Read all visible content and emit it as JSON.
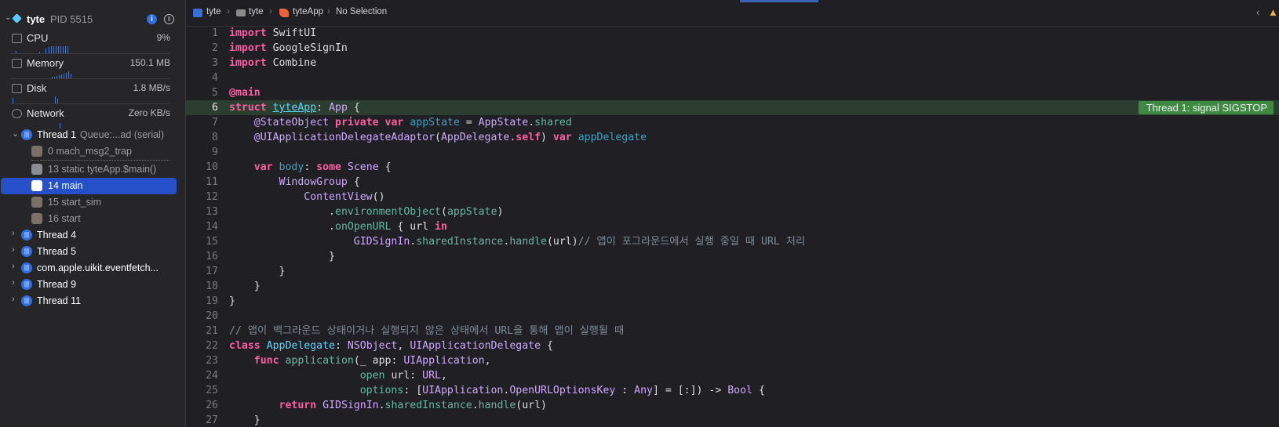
{
  "process": {
    "name": "tyte",
    "pid": "PID 5515"
  },
  "gauges": [
    {
      "label": "CPU",
      "value": "9%"
    },
    {
      "label": "Memory",
      "value": "150.1 MB"
    },
    {
      "label": "Disk",
      "value": "1.8 MB/s"
    },
    {
      "label": "Network",
      "value": "Zero KB/s"
    }
  ],
  "threads": [
    {
      "name": "Thread 1",
      "queue": "Queue:...ad (serial)",
      "expanded": true
    },
    {
      "name": "Thread 4"
    },
    {
      "name": "Thread 5"
    },
    {
      "name": "com.apple.uikit.eventfetch..."
    },
    {
      "name": "Thread 9"
    },
    {
      "name": "Thread 11"
    }
  ],
  "frames": [
    {
      "label": "0 mach_msg2_trap"
    },
    {
      "label": "13 static tyteApp.$main()"
    },
    {
      "label": "14 main",
      "selected": true
    },
    {
      "label": "15 start_sim"
    },
    {
      "label": "16 start"
    }
  ],
  "breadcrumb": {
    "project": "tyte",
    "folder": "tyte",
    "file": "tyteApp",
    "selection": "No Selection"
  },
  "banner": "Thread 1: signal SIGSTOP",
  "code": {
    "l1": {
      "n": "1",
      "kw": "import",
      "rest": " SwiftUI"
    },
    "l2": {
      "n": "2",
      "kw": "import",
      "rest": " GoogleSignIn"
    },
    "l3": {
      "n": "3",
      "kw": "import",
      "rest": " Combine"
    },
    "l4": {
      "n": "4"
    },
    "l5": {
      "n": "5",
      "attr": "@main"
    },
    "l6": {
      "n": "6",
      "kw": "struct",
      "name": "tyteApp",
      "rest": ": ",
      "type": "App",
      "end": " {"
    },
    "l7": {
      "n": "7",
      "attr": "@StateObject",
      "kw1": "private",
      "kw2": "var",
      "prop": "appState",
      "eq": " = ",
      "type": "AppState",
      "dot": ".",
      "member": "shared"
    },
    "l8": {
      "n": "8",
      "attr": "@UIApplicationDelegateAdaptor",
      "open": "(",
      "type": "AppDelegate",
      "dot": ".",
      "kwself": "self",
      "close": ") ",
      "kw": "var",
      "prop": "appDelegate"
    },
    "l9": {
      "n": "9"
    },
    "l10": {
      "n": "10",
      "kw": "var",
      "prop": "body",
      "colon": ": ",
      "kw2": "some",
      "type": "Scene",
      "end": " {"
    },
    "l11": {
      "n": "11",
      "type": "WindowGroup",
      "end": " {"
    },
    "l12": {
      "n": "12",
      "type": "ContentView",
      "end": "()"
    },
    "l13": {
      "n": "13",
      "dot": ".",
      "method": "environmentObject",
      "open": "(",
      "arg": "appState",
      "close": ")"
    },
    "l14": {
      "n": "14",
      "dot": ".",
      "method": "onOpenURL",
      "mid": " { url ",
      "kw": "in"
    },
    "l15": {
      "n": "15",
      "type": "GIDSignIn",
      "dot": ".",
      "member": "sharedInstance",
      "dot2": ".",
      "method": "handle",
      "args": "(url)",
      "comment": "// 앱이 포그라운드에서 실행 중일 때 URL 처리"
    },
    "l16": {
      "n": "16",
      "src": "}"
    },
    "l17": {
      "n": "17",
      "src": "}"
    },
    "l18": {
      "n": "18",
      "src": "}"
    },
    "l19": {
      "n": "19",
      "src": "}"
    },
    "l20": {
      "n": "20"
    },
    "l21": {
      "n": "21",
      "comment": "// 앱이 백그라운드 상태이거나 실행되지 않은 상태에서 URL을 통해 앱이 실행될 때"
    },
    "l22": {
      "n": "22",
      "kw": "class",
      "name": "AppDelegate",
      "colon": ": ",
      "type1": "NSObject",
      "comma": ", ",
      "type2": "UIApplicationDelegate",
      "end": " {"
    },
    "l23": {
      "n": "23",
      "kw": "func",
      "method": "application",
      "open": "(_ app: ",
      "type": "UIApplication",
      "end": ","
    },
    "l24": {
      "n": "24",
      "label": "open",
      "mid": " url: ",
      "type": "URL",
      "end": ","
    },
    "l25": {
      "n": "25",
      "label": "options",
      "mid": ": [",
      "type1": "UIApplication",
      "dot": ".",
      "type2": "OpenURLOptionsKey",
      "mid2": " : ",
      "type3": "Any",
      "mid3": "] = [:]) -> ",
      "type4": "Bool",
      "end": " {"
    },
    "l26": {
      "n": "26",
      "kw": "return",
      "sp": " ",
      "type": "GIDSignIn",
      "dot": ".",
      "member": "sharedInstance",
      "dot2": ".",
      "method": "handle",
      "args": "(url)"
    },
    "l27": {
      "n": "27",
      "src": "}"
    }
  },
  "colors": {
    "selection": "#2550c9",
    "keyword": "#fc5fa3",
    "type": "#d0a8ff",
    "banner": "#3f8a43"
  }
}
